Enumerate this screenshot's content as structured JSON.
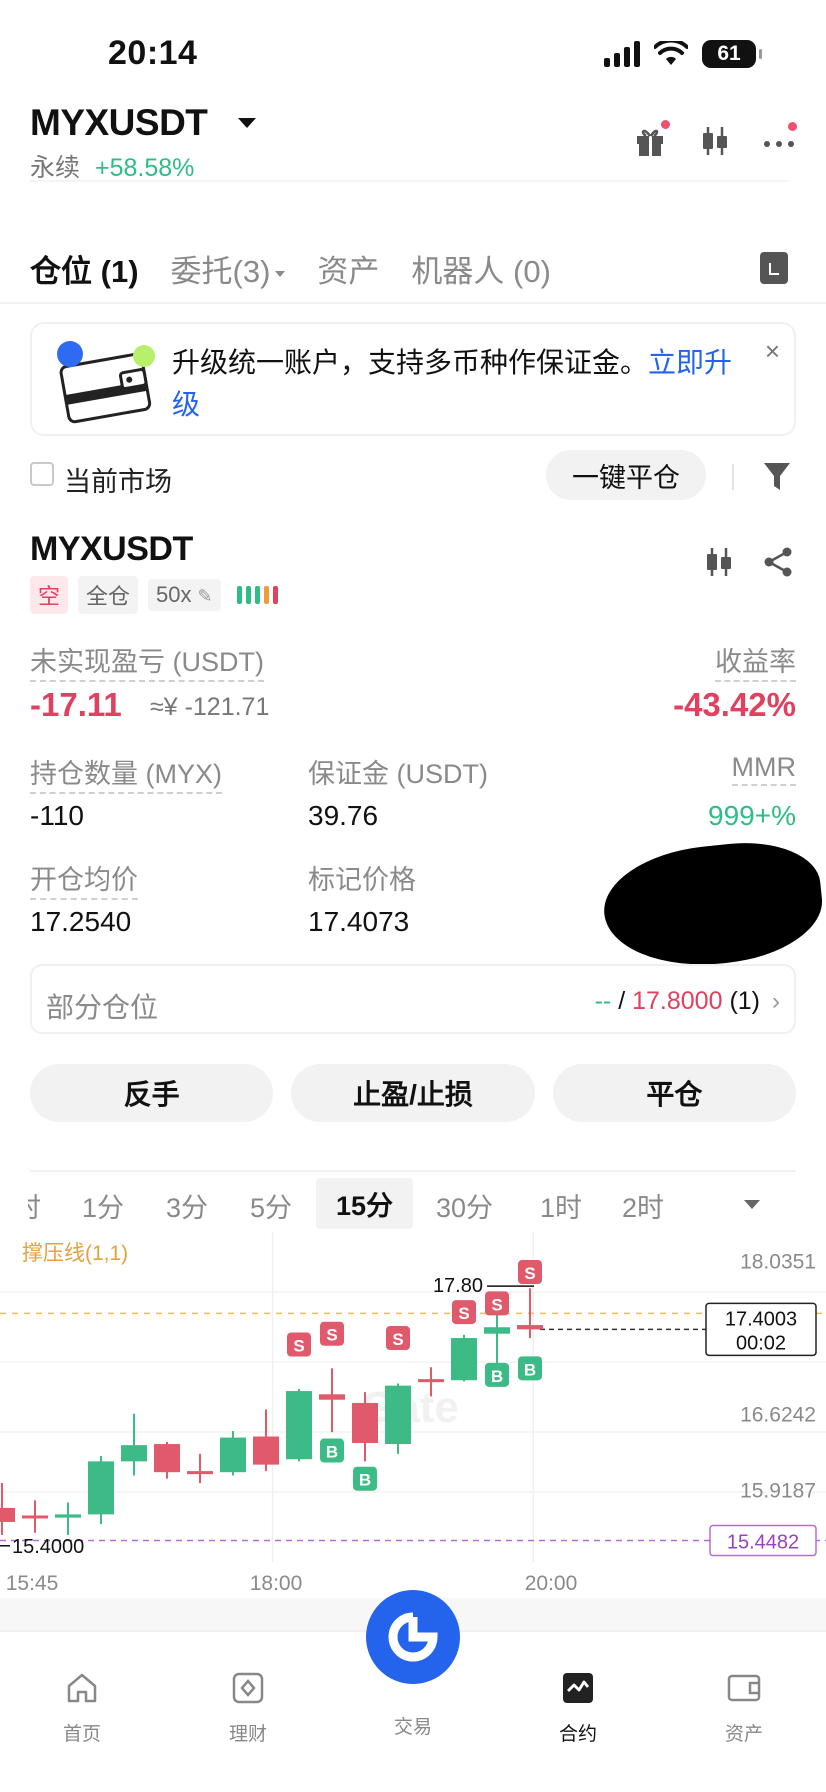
{
  "status_bar": {
    "time": "20:14",
    "battery": "61"
  },
  "header": {
    "symbol": "MYXUSDT",
    "type": "永续",
    "change": "+58.58%"
  },
  "tabs": [
    {
      "label": "仓位",
      "count": "(1)"
    },
    {
      "label": "委托",
      "count": "(3)"
    },
    {
      "label": "资产",
      "count": ""
    },
    {
      "label": "机器人",
      "count": "(0)"
    }
  ],
  "banner": {
    "text": "升级统一账户，支持多币种作保证金。",
    "link": "立即升级",
    "close": "×"
  },
  "filter": {
    "checkbox_label": "当前市场",
    "close_all": "一键平仓"
  },
  "position": {
    "symbol": "MYXUSDT",
    "side": "空",
    "margin_mode": "全仓",
    "leverage": "50x",
    "adl_colors": [
      "#2ebd85",
      "#2ebd85",
      "#2ebd85",
      "#f29b3a",
      "#e0415e"
    ],
    "unrealized_pnl_label": "未实现盈亏 (USDT)",
    "unrealized_pnl": "-17.11",
    "unrealized_pnl_cny": "≈¥ -121.71",
    "roe_label": "收益率",
    "roe": "-43.42%",
    "size_label": "持仓数量 (MYX)",
    "size": "-110",
    "margin_label": "保证金 (USDT)",
    "margin": "39.76",
    "mmr_label": "MMR",
    "mmr": "999+%",
    "entry_label": "开仓均价",
    "entry": "17.2540",
    "mark_label": "标记价格",
    "mark": "17.4073",
    "partial_label": "部分仓位",
    "partial_dash": "--",
    "partial_sep": " / ",
    "partial_price": "17.8000",
    "partial_count": "(1)"
  },
  "actions": {
    "reverse": "反手",
    "tpsl": "止盈/止损",
    "close": "平仓"
  },
  "timeframes": {
    "items": [
      "时",
      "1分",
      "3分",
      "5分",
      "15分",
      "30分",
      "1时",
      "2时"
    ],
    "active": "15分"
  },
  "chart_data": {
    "type": "candlestick",
    "indicator": "撑压线(1,1)",
    "watermark": "Gate",
    "y_ticks": [
      "18.0351",
      "16.6242",
      "15.9187"
    ],
    "ylim": [
      15.25,
      18.3
    ],
    "x_ticks": [
      "15:45",
      "18:00",
      "20:00"
    ],
    "last_price": "17.4003",
    "countdown": "00:02",
    "low_line": "15.4482",
    "low_marker": "15.4000",
    "high_marker": "17.80",
    "colors": {
      "up": "#3dbb86",
      "down": "#e15a6b"
    },
    "candles": [
      {
        "o": 15.75,
        "h": 15.98,
        "l": 15.5,
        "c": 15.62
      },
      {
        "o": 15.68,
        "h": 15.82,
        "l": 15.52,
        "c": 15.66
      },
      {
        "o": 15.66,
        "h": 15.8,
        "l": 15.5,
        "c": 15.69
      },
      {
        "o": 15.69,
        "h": 16.23,
        "l": 15.6,
        "c": 16.18
      },
      {
        "o": 16.18,
        "h": 16.62,
        "l": 16.05,
        "c": 16.33
      },
      {
        "o": 16.34,
        "h": 16.36,
        "l": 16.02,
        "c": 16.08
      },
      {
        "o": 16.09,
        "h": 16.25,
        "l": 15.98,
        "c": 16.07
      },
      {
        "o": 16.08,
        "h": 16.46,
        "l": 16.05,
        "c": 16.4
      },
      {
        "o": 16.41,
        "h": 16.66,
        "l": 16.09,
        "c": 16.15
      },
      {
        "o": 16.2,
        "h": 16.85,
        "l": 16.18,
        "c": 16.83
      },
      {
        "o": 16.8,
        "h": 17.04,
        "l": 16.45,
        "c": 16.75
      },
      {
        "o": 16.72,
        "h": 16.82,
        "l": 16.18,
        "c": 16.35
      },
      {
        "o": 16.34,
        "h": 16.9,
        "l": 16.25,
        "c": 16.88
      },
      {
        "o": 16.94,
        "h": 17.05,
        "l": 16.78,
        "c": 16.92
      },
      {
        "o": 16.93,
        "h": 17.35,
        "l": 16.92,
        "c": 17.32
      },
      {
        "o": 17.36,
        "h": 17.63,
        "l": 17.05,
        "c": 17.42
      },
      {
        "o": 17.44,
        "h": 17.78,
        "l": 17.32,
        "c": 17.4
      }
    ],
    "trade_markers": [
      {
        "i": 9,
        "side": "S",
        "price": 17.26
      },
      {
        "i": 10,
        "side": "S",
        "price": 17.36
      },
      {
        "i": 10,
        "side": "B",
        "price": 16.28
      },
      {
        "i": 11,
        "side": "B",
        "price": 16.02
      },
      {
        "i": 12,
        "side": "S",
        "price": 17.32
      },
      {
        "i": 14,
        "side": "S",
        "price": 17.56
      },
      {
        "i": 15,
        "side": "S",
        "price": 17.64
      },
      {
        "i": 15,
        "side": "B",
        "price": 16.98
      },
      {
        "i": 16,
        "side": "S",
        "price": 17.93
      },
      {
        "i": 16,
        "side": "B",
        "price": 17.04
      }
    ]
  },
  "bottom_nav": [
    {
      "label": "首页",
      "icon": "home-icon"
    },
    {
      "label": "理财",
      "icon": "finance-icon"
    },
    {
      "label": "交易",
      "icon": "trade-icon"
    },
    {
      "label": "合约",
      "icon": "futures-icon"
    },
    {
      "label": "资产",
      "icon": "wallet-icon"
    }
  ]
}
